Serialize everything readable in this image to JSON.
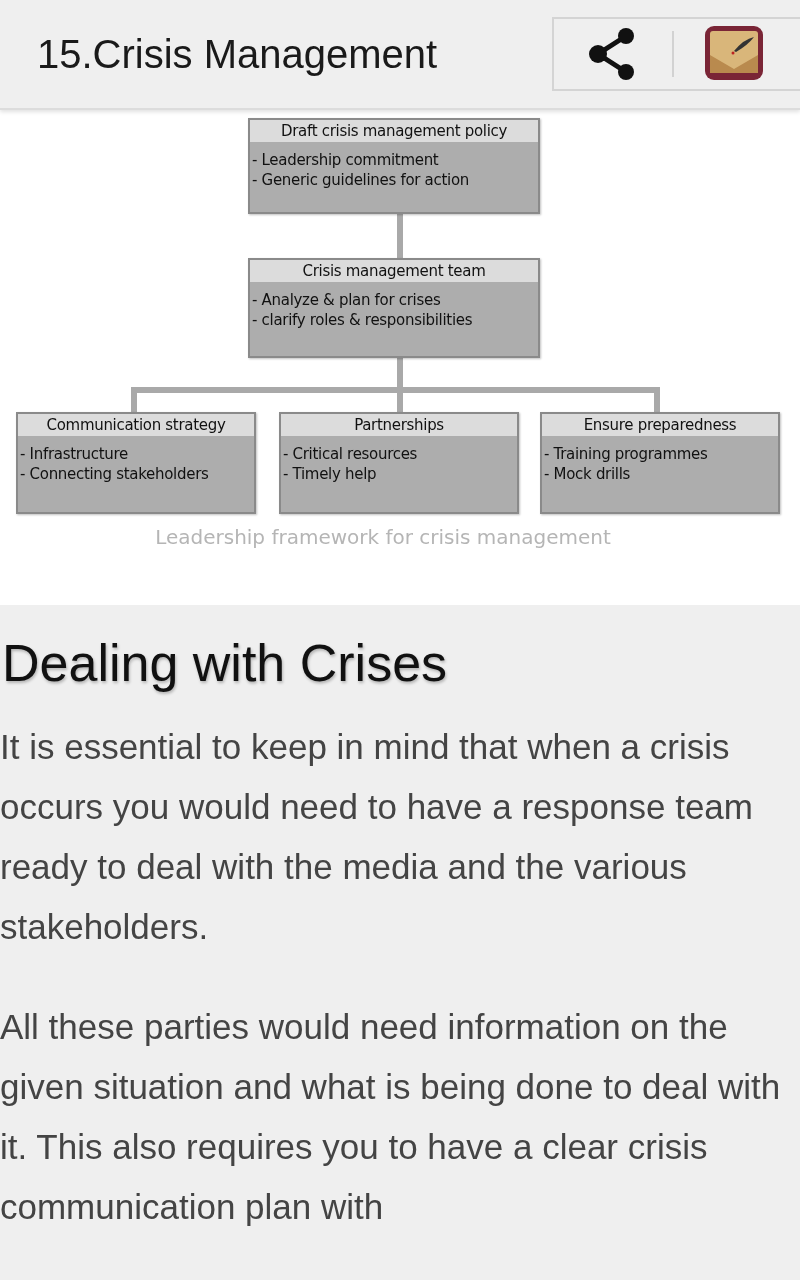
{
  "app_bar": {
    "title": "15.Crisis Management"
  },
  "diagram": {
    "nodes": [
      {
        "title": "Draft crisis management policy",
        "items": [
          "- Leadership commitment",
          "- Generic guidelines for action"
        ]
      },
      {
        "title": "Crisis management team",
        "items": [
          "- Analyze & plan for crises",
          "- clarify roles & responsibilities"
        ]
      },
      {
        "title": "Communication strategy",
        "items": [
          "- Infrastructure",
          "- Connecting stakeholders"
        ]
      },
      {
        "title": "Partnerships",
        "items": [
          "- Critical resources",
          "- Timely help"
        ]
      },
      {
        "title": "Ensure preparedness",
        "items": [
          "- Training programmes",
          "- Mock drills"
        ]
      }
    ],
    "caption": "Leadership framework for crisis management"
  },
  "article": {
    "heading": "Dealing with Crises",
    "paragraphs": [
      "It is essential to keep in mind that when a crisis occurs you would need to have a response team ready to deal with the media and the various stakeholders.",
      "All these parties would need information on the given situation and what is being done to deal with it. This also requires you to have a clear crisis communication plan with"
    ]
  }
}
